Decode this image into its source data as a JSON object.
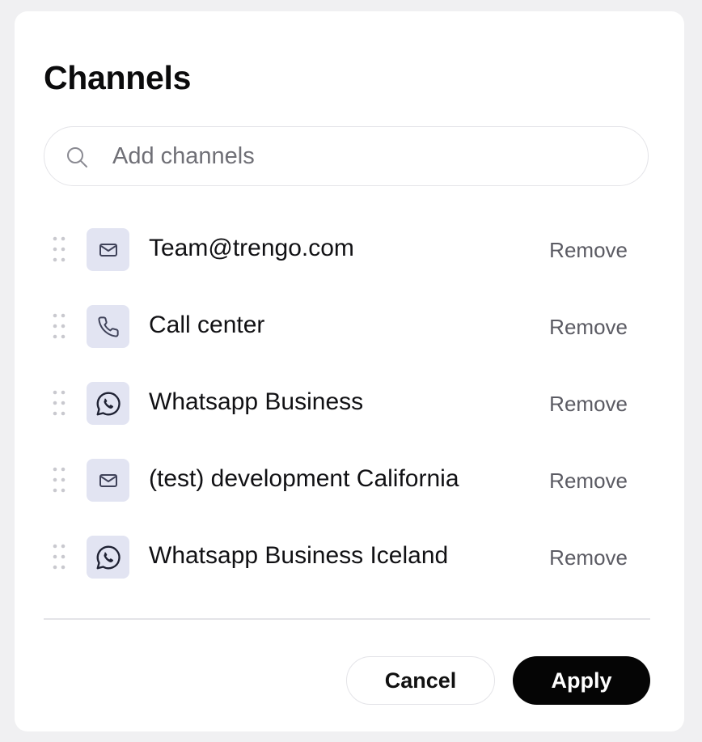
{
  "dialog": {
    "title": "Channels",
    "search": {
      "placeholder": "Add channels",
      "value": ""
    },
    "channels": [
      {
        "name": "Team@trengo.com",
        "icon": "mail-icon",
        "action_label": "Remove"
      },
      {
        "name": "Call center",
        "icon": "phone-icon",
        "action_label": "Remove"
      },
      {
        "name": "Whatsapp Business",
        "icon": "whatsapp-icon",
        "action_label": "Remove"
      },
      {
        "name": "(test) development California",
        "icon": "mail-icon",
        "action_label": "Remove"
      },
      {
        "name": "Whatsapp Business Iceland",
        "icon": "whatsapp-icon",
        "action_label": "Remove"
      }
    ],
    "buttons": {
      "cancel_label": "Cancel",
      "apply_label": "Apply"
    }
  },
  "colors": {
    "primary_button": "#050505",
    "icon_tile": "#e2e4f2",
    "icon_stroke": "#3f4259"
  }
}
